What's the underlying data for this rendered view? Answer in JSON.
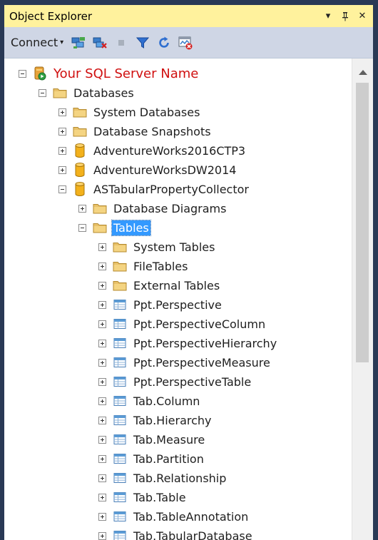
{
  "panel": {
    "title": "Object Explorer",
    "pin_glyph": "⩓",
    "close_glyph": "✕",
    "menu_glyph": "▾"
  },
  "toolbar": {
    "connect_label": "Connect",
    "caret": "▾",
    "icons": [
      "connect-object-icon",
      "disconnect-icon",
      "stop-icon",
      "filter-icon",
      "refresh-icon",
      "activity-monitor-icon"
    ]
  },
  "colors": {
    "title_bar": "#FFF29D",
    "toolbar": "#CFD6E5",
    "server_name": "#D01010",
    "selection": "#3399FF",
    "folder": "#E8C16A",
    "database": "#F3B11C",
    "table": "#5B9BD5"
  },
  "tree": [
    {
      "label": "Your SQL Server Name",
      "level": 0,
      "expander": "minus",
      "icon": "server",
      "style": "server"
    },
    {
      "label": "Databases",
      "level": 1,
      "expander": "minus",
      "icon": "folder"
    },
    {
      "label": "System Databases",
      "level": 2,
      "expander": "plus",
      "icon": "folder"
    },
    {
      "label": "Database Snapshots",
      "level": 2,
      "expander": "plus",
      "icon": "folder"
    },
    {
      "label": "AdventureWorks2016CTP3",
      "level": 2,
      "expander": "plus",
      "icon": "database"
    },
    {
      "label": "AdventureWorksDW2014",
      "level": 2,
      "expander": "plus",
      "icon": "database"
    },
    {
      "label": "ASTabularPropertyCollector",
      "level": 2,
      "expander": "minus",
      "icon": "database"
    },
    {
      "label": "Database Diagrams",
      "level": 3,
      "expander": "plus",
      "icon": "folder"
    },
    {
      "label": "Tables",
      "level": 3,
      "expander": "minus",
      "icon": "folder",
      "style": "sel"
    },
    {
      "label": "System Tables",
      "level": 4,
      "expander": "plus",
      "icon": "folder"
    },
    {
      "label": "FileTables",
      "level": 4,
      "expander": "plus",
      "icon": "folder"
    },
    {
      "label": "External Tables",
      "level": 4,
      "expander": "plus",
      "icon": "folder"
    },
    {
      "label": "Ppt.Perspective",
      "level": 4,
      "expander": "plus",
      "icon": "table"
    },
    {
      "label": "Ppt.PerspectiveColumn",
      "level": 4,
      "expander": "plus",
      "icon": "table"
    },
    {
      "label": "Ppt.PerspectiveHierarchy",
      "level": 4,
      "expander": "plus",
      "icon": "table"
    },
    {
      "label": "Ppt.PerspectiveMeasure",
      "level": 4,
      "expander": "plus",
      "icon": "table"
    },
    {
      "label": "Ppt.PerspectiveTable",
      "level": 4,
      "expander": "plus",
      "icon": "table"
    },
    {
      "label": "Tab.Column",
      "level": 4,
      "expander": "plus",
      "icon": "table"
    },
    {
      "label": "Tab.Hierarchy",
      "level": 4,
      "expander": "plus",
      "icon": "table"
    },
    {
      "label": "Tab.Measure",
      "level": 4,
      "expander": "plus",
      "icon": "table"
    },
    {
      "label": "Tab.Partition",
      "level": 4,
      "expander": "plus",
      "icon": "table"
    },
    {
      "label": "Tab.Relationship",
      "level": 4,
      "expander": "plus",
      "icon": "table"
    },
    {
      "label": "Tab.Table",
      "level": 4,
      "expander": "plus",
      "icon": "table"
    },
    {
      "label": "Tab.TableAnnotation",
      "level": 4,
      "expander": "plus",
      "icon": "table"
    },
    {
      "label": "Tab.TabularDatabase",
      "level": 4,
      "expander": "plus",
      "icon": "table"
    }
  ]
}
